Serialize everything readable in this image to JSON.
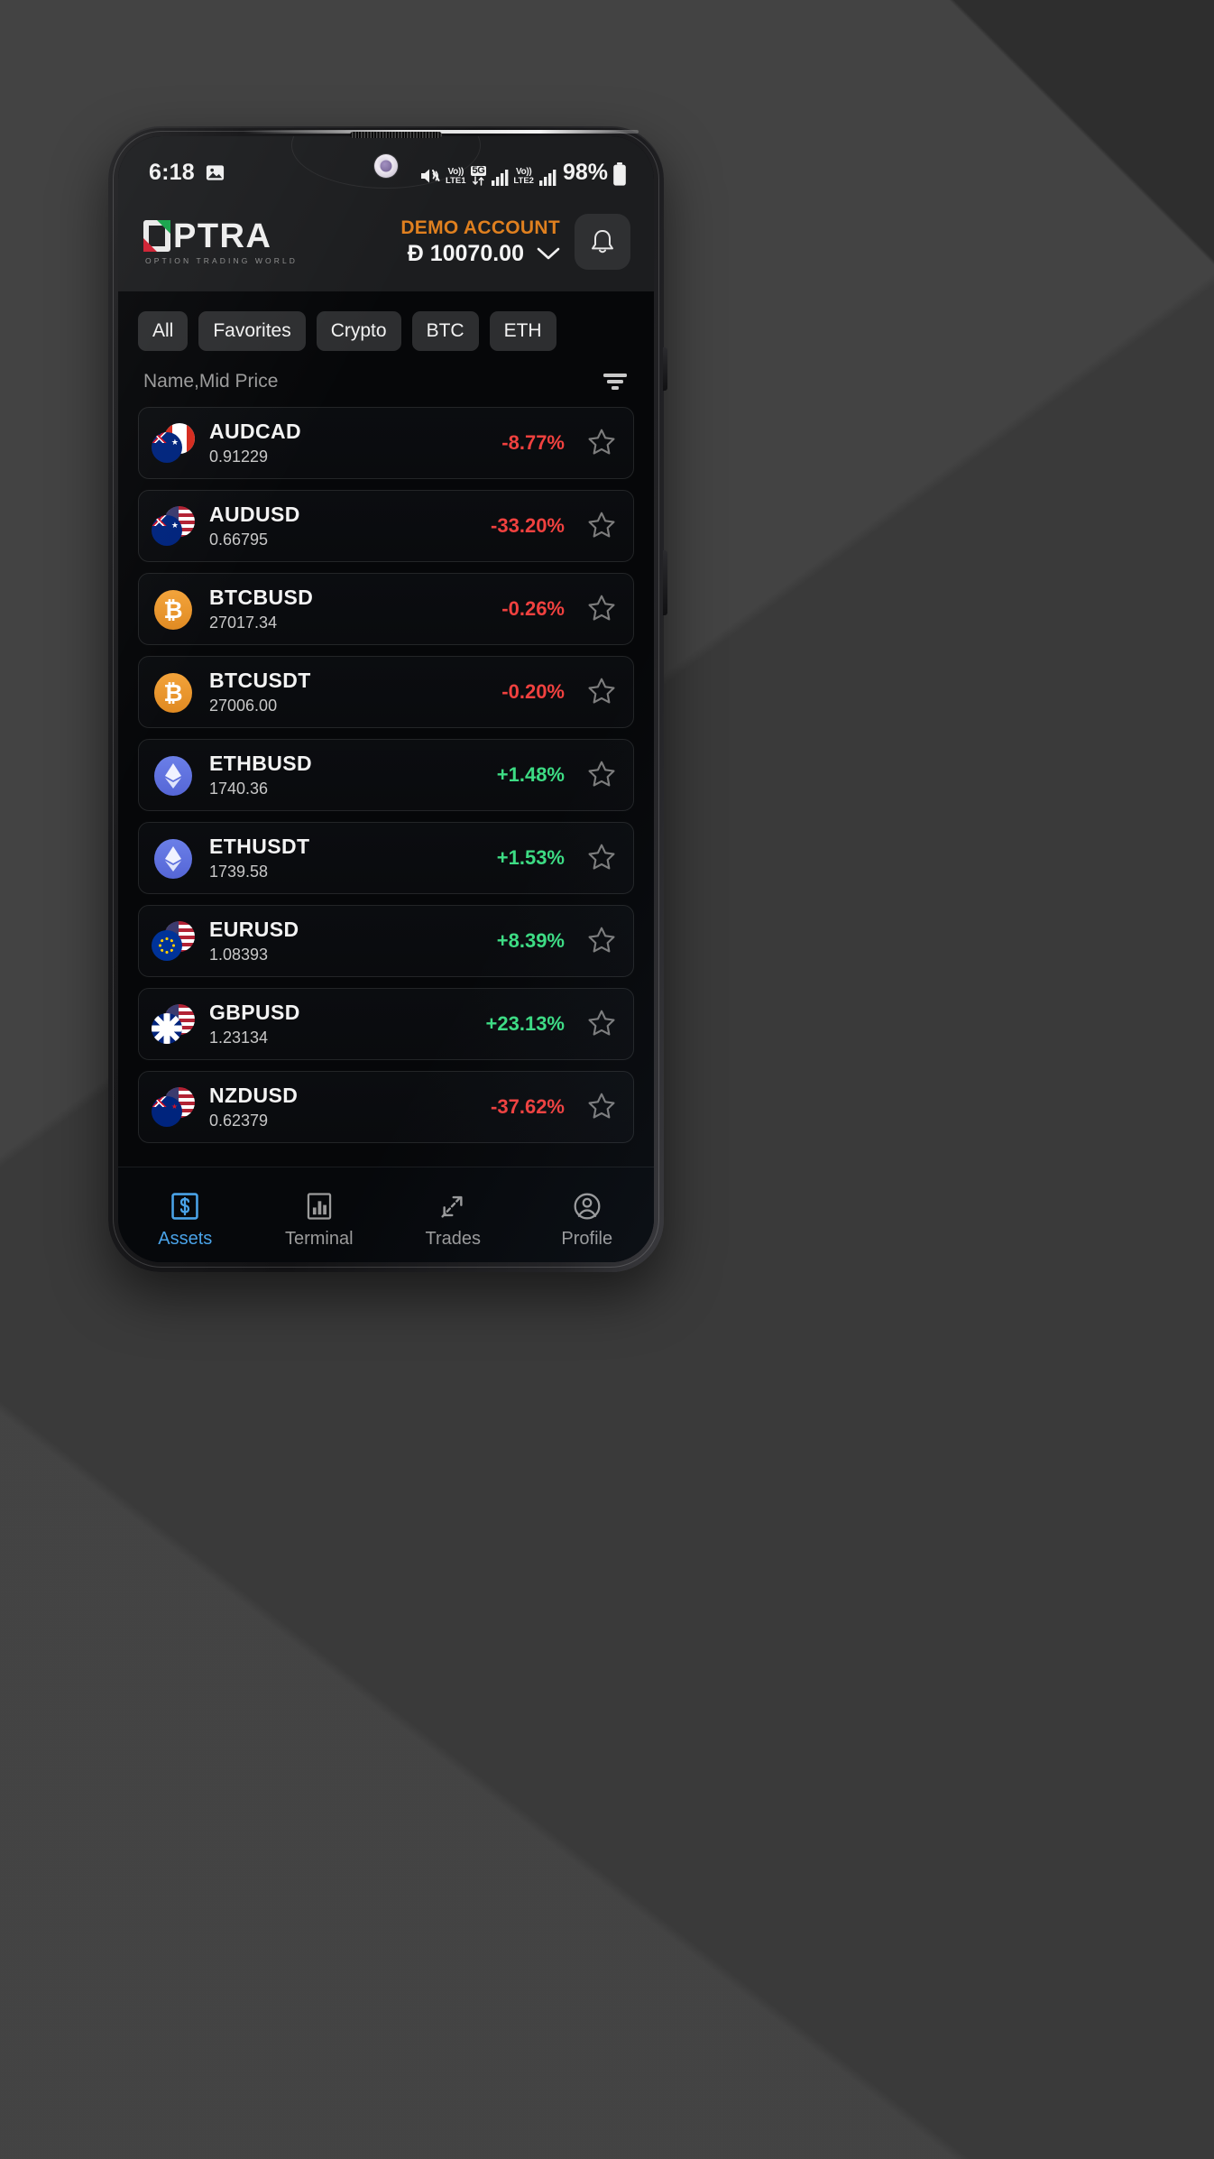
{
  "status_bar": {
    "time": "6:18",
    "photo_icon": "image-icon",
    "mute_icon": "mute-icon",
    "volte1_top": "Vo))",
    "volte1_bottom": "LTE1",
    "network_5g": "5G",
    "volte2_top": "Vo))",
    "volte2_bottom": "LTE2",
    "battery_percent": "98%",
    "battery_icon": "battery-icon"
  },
  "header": {
    "logo_text": "PTRA",
    "logo_tagline": "OPTION TRADING WORLD",
    "account_label": "DEMO ACCOUNT",
    "balance": "Đ 10070.00",
    "chevron_icon": "chevron-down-icon",
    "bell_icon": "bell-icon"
  },
  "filters": {
    "chips": [
      {
        "label": "All"
      },
      {
        "label": "Favorites"
      },
      {
        "label": "Crypto"
      },
      {
        "label": "BTC"
      },
      {
        "label": "ETH"
      }
    ]
  },
  "sort": {
    "label": "Name,Mid Price",
    "filter_icon": "filter-icon"
  },
  "assets": [
    {
      "name": "AUDCAD",
      "price": "0.91229",
      "change": "-8.77%",
      "direction": "down",
      "icon": "flag-pair-aud-cad",
      "flag_back": "fl-ca",
      "flag_front": "fl-au",
      "star_icon": "star-outline-icon"
    },
    {
      "name": "AUDUSD",
      "price": "0.66795",
      "change": "-33.20%",
      "direction": "down",
      "icon": "flag-pair-aud-usd",
      "flag_back": "fl-us",
      "flag_front": "fl-au",
      "star_icon": "star-outline-icon"
    },
    {
      "name": "BTCBUSD",
      "price": "27017.34",
      "change": "-0.26%",
      "direction": "down",
      "icon": "bitcoin-icon",
      "coin_class": "coin-btc",
      "coin_glyph": "₿",
      "star_icon": "star-outline-icon"
    },
    {
      "name": "BTCUSDT",
      "price": "27006.00",
      "change": "-0.20%",
      "direction": "down",
      "icon": "bitcoin-icon",
      "coin_class": "coin-btc",
      "coin_glyph": "₿",
      "star_icon": "star-outline-icon"
    },
    {
      "name": "ETHBUSD",
      "price": "1740.36",
      "change": "+1.48%",
      "direction": "up",
      "icon": "ethereum-icon",
      "coin_class": "coin-eth",
      "coin_glyph": "◆",
      "star_icon": "star-outline-icon"
    },
    {
      "name": "ETHUSDT",
      "price": "1739.58",
      "change": "+1.53%",
      "direction": "up",
      "icon": "ethereum-icon",
      "coin_class": "coin-eth",
      "coin_glyph": "◆",
      "star_icon": "star-outline-icon"
    },
    {
      "name": "EURUSD",
      "price": "1.08393",
      "change": "+8.39%",
      "direction": "up",
      "icon": "flag-pair-eur-usd",
      "flag_back": "fl-us",
      "flag_front": "fl-eu",
      "star_icon": "star-outline-icon"
    },
    {
      "name": "GBPUSD",
      "price": "1.23134",
      "change": "+23.13%",
      "direction": "up",
      "icon": "flag-pair-gbp-usd",
      "flag_back": "fl-us",
      "flag_front": "fl-gb",
      "star_icon": "star-outline-icon"
    },
    {
      "name": "NZDUSD",
      "price": "0.62379",
      "change": "-37.62%",
      "direction": "down",
      "icon": "flag-pair-nzd-usd",
      "flag_back": "fl-us",
      "flag_front": "fl-nz",
      "star_icon": "star-outline-icon"
    }
  ],
  "bottom_nav": [
    {
      "label": "Assets",
      "icon": "dollar-square-icon",
      "active": true
    },
    {
      "label": "Terminal",
      "icon": "bar-chart-icon",
      "active": false
    },
    {
      "label": "Trades",
      "icon": "exchange-arrows-icon",
      "active": false
    },
    {
      "label": "Profile",
      "icon": "person-circle-icon",
      "active": false
    }
  ],
  "colors": {
    "accent_orange": "#e0801f",
    "accent_blue": "#4aa3e8",
    "up_green": "#3ddc84",
    "down_red": "#f0413f",
    "screen_bg": "#060709",
    "header_bg": "#1c1d1f"
  }
}
